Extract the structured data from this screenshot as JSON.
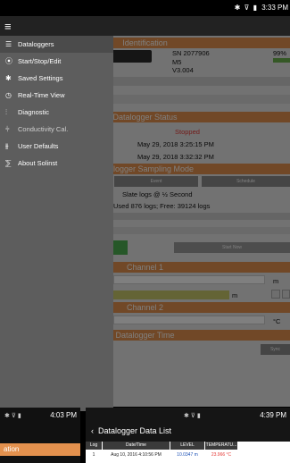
{
  "status_bar": {
    "icons": "✱ ⊽ ▮",
    "time": "3:33 PM"
  },
  "main": {
    "identification_label": "Identification",
    "serial": "SN 2077906",
    "model": "M5",
    "version": "V3.004",
    "battery": "99%",
    "status_label": "Datalogger Status",
    "state": "Stopped",
    "start_time": "May 29, 2018 3:25:15 PM",
    "stop_time": "May 29, 2018 3:32:32 PM",
    "sampling_label": "Datalogger Sampling Mode",
    "event_button": "Event",
    "schedule_button": "Schedule",
    "rate_text": "Slate logs @ ½ Second",
    "used_text": "Used 876 logs; Free: 39124 logs",
    "start_button": "Start Now",
    "channel1_label": "Channel 1",
    "channel1_unit_m": "m",
    "channel1_unit_m2": "m",
    "channel2_label": "Channel 2",
    "channel2_unit": "°C",
    "time_label": "Datalogger Time",
    "sync_button": "Sync"
  },
  "menu": {
    "items": [
      {
        "label": "Dataloggers",
        "icon": "list-icon"
      },
      {
        "label": "Start/Stop/Edit",
        "icon": "record-icon"
      },
      {
        "label": "Saved Settings",
        "icon": "gear-icon"
      },
      {
        "label": "Real-Time View",
        "icon": "stopwatch-icon"
      },
      {
        "label": "Diagnostic",
        "icon": "diagnostic-icon"
      },
      {
        "label": "Conductivity Cal.",
        "icon": "conductivity-icon"
      },
      {
        "label": "User Defaults",
        "icon": "defaults-icon"
      },
      {
        "label": "About Solinst",
        "icon": "about-icon"
      }
    ]
  },
  "thumb_left": {
    "time": "4:03 PM",
    "section": "ation"
  },
  "thumb_right": {
    "time": "4:39 PM",
    "title": "Datalogger Data List",
    "headers": [
      "Log",
      "Date/Time",
      "LEVEL",
      "TEMPERATU..."
    ],
    "row": [
      "1",
      "Aug 10, 2016 4:10:56 PM",
      "10.0347 m",
      "23.966 °C"
    ]
  },
  "colors": {
    "accent": "#e3914e",
    "menu": "#5d5d5d",
    "state_red": "#e53935",
    "level_blue": "#1a4fb5"
  }
}
